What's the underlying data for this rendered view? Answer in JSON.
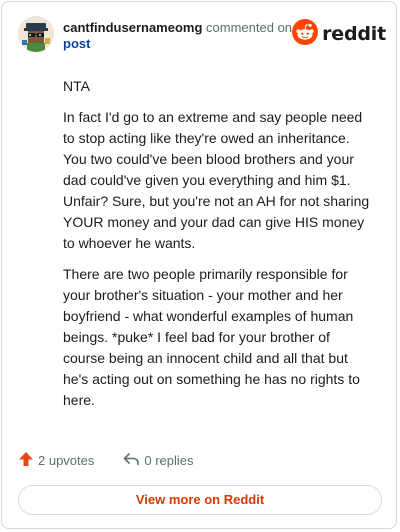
{
  "comment": {
    "author": "cantfindusernameomg",
    "action": " commented on",
    "post_link": "post",
    "paragraphs": [
      "NTA",
      "In fact I'd go to an extreme and say people need to stop acting like they're owed an inheritance. You two could've been blood brothers and your dad could've given you everything and him $1. Unfair? Sure, but you're not an AH for not sharing YOUR money and your dad can give HIS money to whoever he wants.",
      "There are two people primarily responsible for your brother's situation - your mother and her boyfriend - what wonderful examples of human beings. *puke* I feel bad for your brother of course being an innocent child and all that but he's acting out on something he has no rights to here."
    ],
    "upvotes": "2 upvotes",
    "replies": "0 replies"
  },
  "brand": {
    "wordmark": "reddit",
    "color": "#ff4500",
    "icon": "reddit-snoo-icon"
  },
  "actions": {
    "view_more": "View more on Reddit"
  },
  "colors": {
    "upvote_arrow": "#e0481a",
    "link": "#0a449b",
    "button_text": "#d93a00",
    "muted": "#576f76"
  }
}
